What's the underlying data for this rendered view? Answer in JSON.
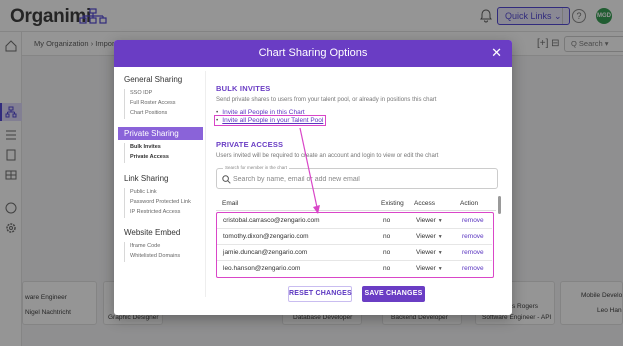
{
  "app": {
    "logo_text": "Organimi",
    "quick_links_label": "Quick Links ⌄",
    "help_glyph": "?",
    "avatar_initials": "MGD",
    "breadcrumb": "My Organization  ›  Import",
    "search_label": "Q  Search  ▾",
    "sub_icons": "[+]  ⊟",
    "cards": [
      {
        "name": "ware Engineer"
      },
      {
        "name": "Nigel Nachtricht"
      },
      {
        "role": "Graphic Designer"
      },
      {
        "role": "Database Developer"
      },
      {
        "role": "Backend Developer"
      },
      {
        "name": "s Rogers"
      },
      {
        "role": "Software Engineer - API"
      },
      {
        "role": "Mobile Develo"
      },
      {
        "name": "Leo Han"
      }
    ]
  },
  "modal": {
    "title": "Chart Sharing Options",
    "close_glyph": "✕",
    "sidebar": {
      "sections": [
        {
          "label": "General Sharing",
          "items": [
            "SSO IDP",
            "Full Roster Access",
            "Chart Positions"
          ]
        },
        {
          "label": "Private Sharing",
          "items": [
            "Bulk Invites",
            "Private Access"
          ]
        },
        {
          "label": "Link Sharing",
          "items": [
            "Public Link",
            "Password Protected Link",
            "IP Restricted Access"
          ]
        },
        {
          "label": "Website Embed",
          "items": [
            "Iframe Code",
            "Whitelisted Domains"
          ]
        }
      ]
    },
    "bulk_invites": {
      "heading": "BULK INVITES",
      "description": "Send private shares to users from your talent pool, or already in positions this chart",
      "links": [
        "Invite all People in this Chart",
        "Invite all People in your Talent Pool"
      ]
    },
    "private_access": {
      "heading": "PRIVATE ACCESS",
      "description": "Users invited will be required to create an account and login to view or edit the chart",
      "search_legend": "Search for member in the chart",
      "search_placeholder": "Search by name, email or add new email",
      "columns": [
        "Email",
        "Existing",
        "Access",
        "Action"
      ],
      "rows": [
        {
          "email": "cristobal.carrasco@zengario.com",
          "existing": "no",
          "access": "Viewer",
          "action": "remove"
        },
        {
          "email": "tomothy.dixon@zengario.com",
          "existing": "no",
          "access": "Viewer",
          "action": "remove"
        },
        {
          "email": "jamie.duncan@zengario.com",
          "existing": "no",
          "access": "Viewer",
          "action": "remove"
        },
        {
          "email": "leo.hanson@zengario.com",
          "existing": "no",
          "access": "Viewer",
          "action": "remove"
        }
      ]
    },
    "buttons": {
      "reset": "RESET CHANGES",
      "save": "SAVE CHANGES"
    }
  },
  "colors": {
    "brand": "#6a3dc4",
    "highlight": "#d946c8",
    "link": "#5a34c0"
  }
}
